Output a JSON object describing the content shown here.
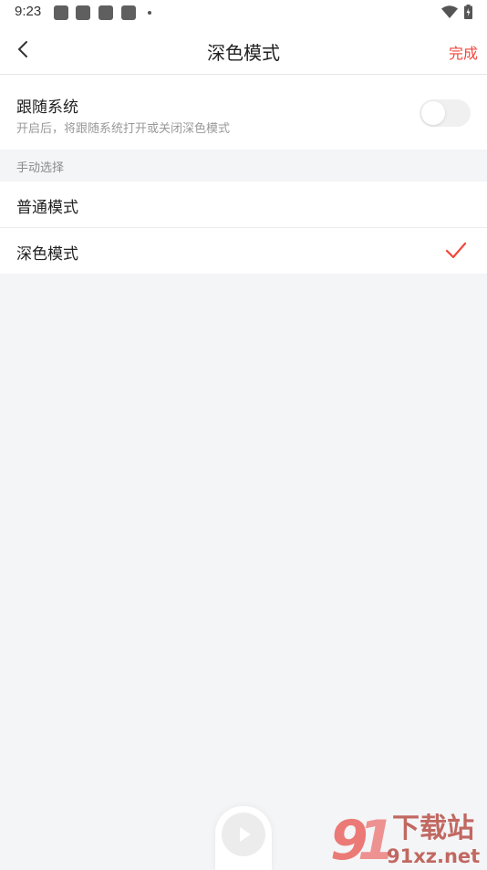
{
  "status_bar": {
    "time": "9:23"
  },
  "nav": {
    "title": "深色模式",
    "done_label": "完成"
  },
  "follow_system": {
    "title": "跟随系统",
    "description": "开启后，将跟随系统打开或关闭深色模式",
    "enabled": false
  },
  "manual": {
    "section_label": "手动选择",
    "options": [
      {
        "label": "普通模式",
        "selected": false
      },
      {
        "label": "深色模式",
        "selected": true
      }
    ]
  },
  "watermark": {
    "text": "91xz.net",
    "label": "下载站"
  },
  "colors": {
    "accent": "#f0473c",
    "background": "#f4f5f7"
  }
}
